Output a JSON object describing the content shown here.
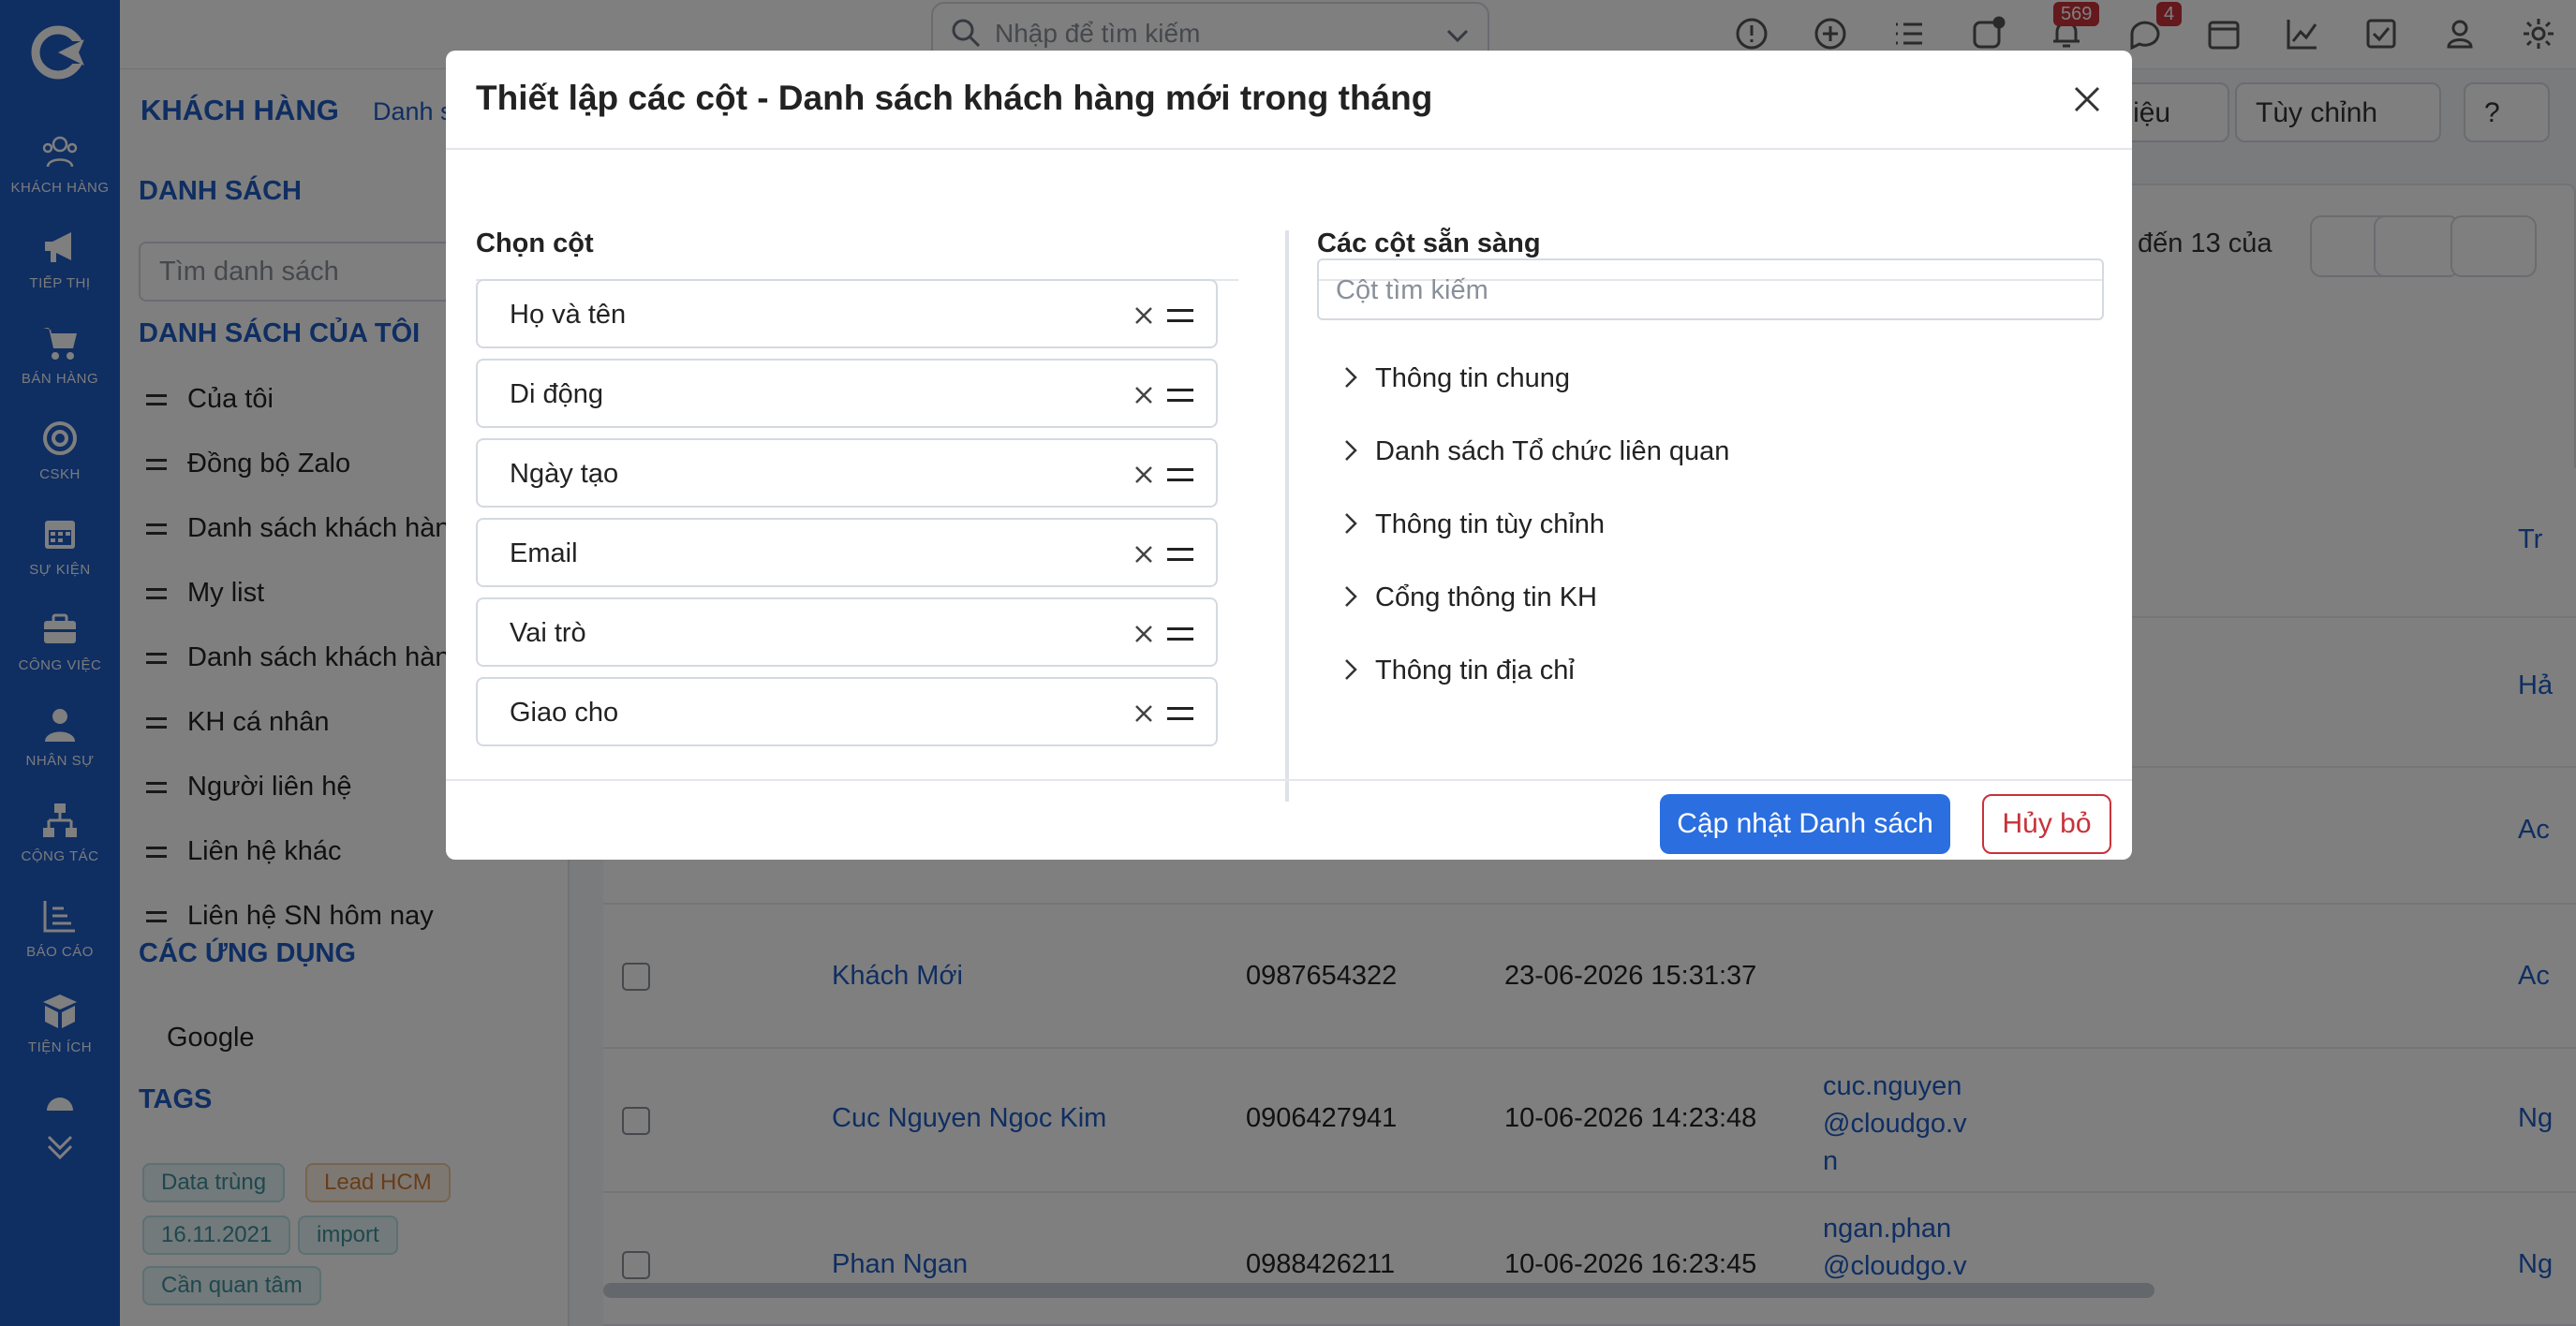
{
  "rail": [
    {
      "label": "KHÁCH HÀNG",
      "icon": "users-icon"
    },
    {
      "label": "TIẾP THỊ",
      "icon": "megaphone-icon"
    },
    {
      "label": "BÁN HÀNG",
      "icon": "cart-icon"
    },
    {
      "label": "CSKH",
      "icon": "lifebuoy-icon"
    },
    {
      "label": "SỰ KIỆN",
      "icon": "calendar-icon"
    },
    {
      "label": "CÔNG VIỆC",
      "icon": "briefcase-icon"
    },
    {
      "label": "NHÂN SỰ",
      "icon": "person-icon"
    },
    {
      "label": "CỘNG TÁC",
      "icon": "org-chart-icon"
    },
    {
      "label": "BÁO CÁO",
      "icon": "report-icon"
    },
    {
      "label": "TIỆN ÍCH",
      "icon": "box-icon"
    }
  ],
  "topbar": {
    "search_placeholder": "Nhập để tìm kiếm",
    "notif_count": "569",
    "chat_count": "4"
  },
  "breadcrumb": {
    "root": "KHÁCH HÀNG",
    "current": "Danh s"
  },
  "sidebar": {
    "list_heading": "DANH SÁCH",
    "search_placeholder": "Tìm danh sách",
    "my_lists_heading": "DANH SÁCH CỦA TÔI",
    "items": [
      "Của tôi",
      "Đồng bộ Zalo",
      "Danh sách khách hàn",
      "My list",
      "Danh sách khách hàn",
      "KH cá nhân",
      "Người liên hệ",
      "Liên hệ khác",
      "Liên hệ SN hôm nay"
    ],
    "apps_heading": "CÁC ỨNG DỤNG",
    "app_google": "Google",
    "tags_heading": "TAGS",
    "tags": [
      "Data trùng",
      "Lead HCM",
      "16.11.2021",
      "import",
      "Cần quan tâm"
    ]
  },
  "main": {
    "btn_data": "ữ liệu",
    "btn_customize": "Tùy chỉnh",
    "pager_text": "đến 13 của",
    "rows": [
      {
        "name": "Khách Mới",
        "phone": "0987654322",
        "created": "23-06-2026 15:31:37",
        "email": "",
        "assignee": "Ac"
      },
      {
        "name": "Cuc Nguyen Ngoc Kim",
        "phone": "0906427941",
        "created": "10-06-2026 14:23:48",
        "email": "cuc.nguyen @cloudgo.v n",
        "assignee": "Ng"
      },
      {
        "name": "Phan Ngan",
        "phone": "0988426211",
        "created": "10-06-2026 16:23:45",
        "email": "ngan.phan @cloudgo.v",
        "assignee": "Ng"
      }
    ],
    "right_col_partial": [
      "Tr",
      "Hả",
      "Ac"
    ]
  },
  "modal": {
    "title": "Thiết lập các cột - Danh sách khách hàng mới trong tháng",
    "chosen_heading": "Chọn cột",
    "chosen": [
      "Họ và tên",
      "Di động",
      "Ngày tạo",
      "Email",
      "Vai trò",
      "Giao cho"
    ],
    "available_heading": "Các cột sẵn sàng",
    "search_placeholder": "Cột tìm kiếm",
    "groups": [
      "Thông tin chung",
      "Danh sách Tổ chức liên quan",
      "Thông tin tùy chỉnh",
      "Cổng thông tin KH",
      "Thông tin địa chỉ"
    ],
    "update_button": "Cập nhật Danh sách",
    "cancel_button": "Hủy bỏ"
  }
}
